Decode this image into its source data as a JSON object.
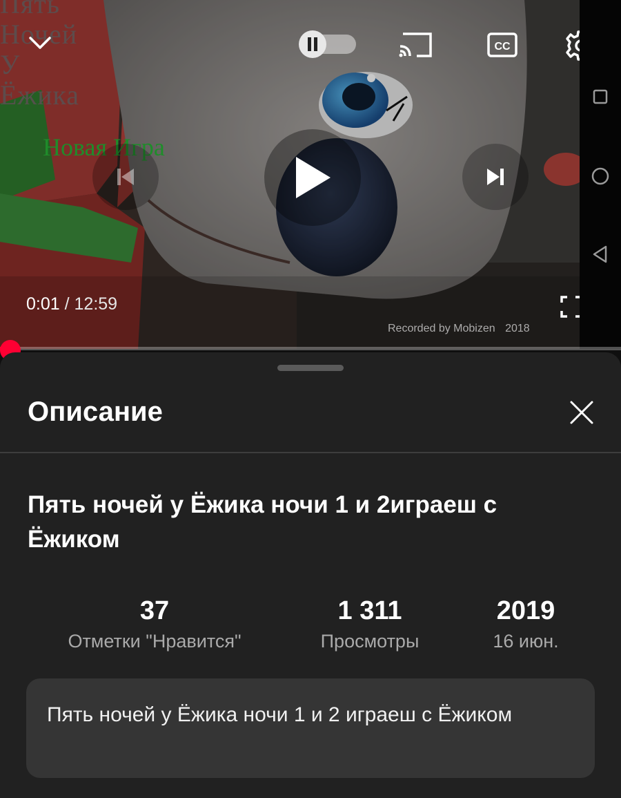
{
  "player": {
    "overlay_title_lines": [
      "Пять",
      "Ночей",
      "У",
      "Ёжика"
    ],
    "overlay_subtitle": "Новая Игра",
    "watermark": "Recorded by Mobizen",
    "watermark_year": "2018",
    "current_time": "0:01",
    "time_separator": " / ",
    "duration": "12:59",
    "progress_fraction": 0.0013,
    "icons": {
      "collapse": "chevron-down-icon",
      "autoplay": "autoplay-toggle-icon",
      "cast": "cast-icon",
      "captions": "captions-cc-icon",
      "settings": "gear-icon",
      "previous": "skip-previous-icon",
      "play": "play-icon",
      "next": "skip-next-icon",
      "fullscreen": "fullscreen-icon"
    },
    "autoplay_on": false,
    "accent_color": "#ff0033"
  },
  "system_nav": {
    "icons": [
      "recents-square-icon",
      "home-circle-icon",
      "back-triangle-icon"
    ]
  },
  "sheet": {
    "title": "Описание",
    "video_title": "Пять ночей у Ёжика ночи 1 и 2играеш с Ёжиком",
    "stats": [
      {
        "value": "37",
        "label": "Отметки \"Нравится\""
      },
      {
        "value": "1 311",
        "label": "Просмотры"
      },
      {
        "value": "2019",
        "label": "16 июн."
      }
    ],
    "description": "Пять ночей у Ёжика ночи 1 и 2 играеш с Ёжиком"
  }
}
